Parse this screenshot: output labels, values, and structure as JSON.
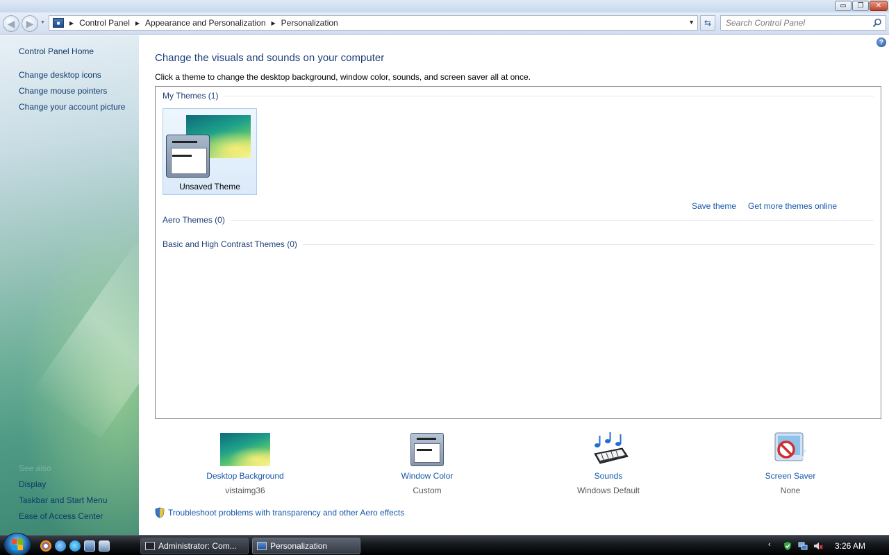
{
  "window": {
    "minimize": "▭",
    "maximize": "❐",
    "close": "✕"
  },
  "address": {
    "crumbs": [
      "Control Panel",
      "Appearance and Personalization",
      "Personalization"
    ]
  },
  "search": {
    "placeholder": "Search Control Panel"
  },
  "sidebar": {
    "home": "Control Panel Home",
    "tasks": [
      "Change desktop icons",
      "Change mouse pointers",
      "Change your account picture"
    ],
    "see_also_title": "See also",
    "see_also": [
      "Display",
      "Taskbar and Start Menu",
      "Ease of Access Center"
    ]
  },
  "main": {
    "title": "Change the visuals and sounds on your computer",
    "description": "Click a theme to change the desktop background, window color, sounds, and screen saver all at once.",
    "groups": {
      "my_themes": "My Themes (1)",
      "aero_themes": "Aero Themes (0)",
      "basic_themes": "Basic and High Contrast Themes (0)"
    },
    "theme_tile_name": "Unsaved Theme",
    "save_theme": "Save theme",
    "more_themes": "Get more themes online",
    "settings": [
      {
        "title": "Desktop Background",
        "value": "vistaimg36",
        "icon": "desktop-background-icon"
      },
      {
        "title": "Window Color",
        "value": "Custom",
        "icon": "window-color-icon"
      },
      {
        "title": "Sounds",
        "value": "Windows Default",
        "icon": "sounds-icon"
      },
      {
        "title": "Screen Saver",
        "value": "None",
        "icon": "screen-saver-icon"
      }
    ],
    "troubleshoot": "Troubleshoot problems with transparency and other Aero effects"
  },
  "taskbar": {
    "tasks": [
      "Administrator: Com...",
      "Personalization"
    ],
    "clock": "3:26 AM"
  },
  "colors": {
    "link": "#1557a8",
    "heading": "#1e3f78",
    "taskbar": "#15181d"
  }
}
